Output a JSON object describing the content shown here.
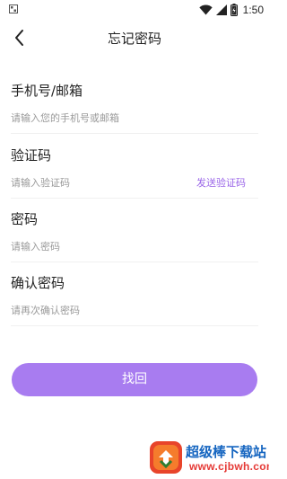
{
  "status_bar": {
    "time": "1:50"
  },
  "header": {
    "title": "忘记密码",
    "back_icon": "chevron-left-icon"
  },
  "form": {
    "account": {
      "label": "手机号/邮箱",
      "placeholder": "请输入您的手机号或邮箱",
      "value": ""
    },
    "code": {
      "label": "验证码",
      "placeholder": "请输入验证码",
      "value": "",
      "send_label": "发送验证码"
    },
    "password": {
      "label": "密码",
      "placeholder": "请输入密码",
      "value": ""
    },
    "confirm": {
      "label": "确认密码",
      "placeholder": "请再次确认密码",
      "value": ""
    }
  },
  "submit": {
    "label": "找回"
  },
  "watermark": {
    "title": "超级棒下载站",
    "url": "www.cjbwh.com"
  },
  "colors": {
    "accent": "#a87cf0",
    "link": "#9b67e8",
    "text": "#222222",
    "placeholder": "#9a9a9a"
  }
}
